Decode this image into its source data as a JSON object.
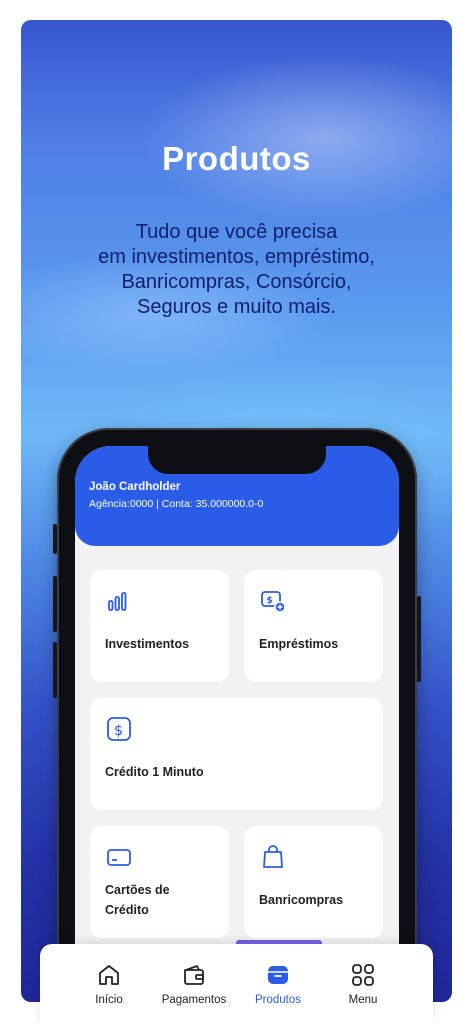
{
  "promo": {
    "title": "Produtos",
    "subtitle_lines": [
      "Tudo que você precisa",
      "em investimentos, empréstimo,",
      "Banricompras, Consórcio,",
      "Seguros e muito mais."
    ]
  },
  "account": {
    "name": "João Cardholder",
    "details": "Agência:0000  | Conta: 35.000000.0-0"
  },
  "products": [
    {
      "label": "Investimentos",
      "icon": "bar-chart-icon"
    },
    {
      "label": "Empréstimos",
      "icon": "loan-money-icon"
    },
    {
      "label": "Crédito 1 Minuto",
      "icon": "dollar-icon"
    },
    {
      "label_lines": [
        "Cartões de",
        "Crédito"
      ],
      "icon": "credit-card-icon"
    },
    {
      "label": "Banricompras",
      "icon": "shopping-bag-icon"
    }
  ],
  "nav": {
    "items": [
      {
        "label": "Início",
        "icon": "home-icon"
      },
      {
        "label": "Pagamentos",
        "icon": "wallet-icon"
      },
      {
        "label": "Produtos",
        "icon": "products-box-icon",
        "active": true
      },
      {
        "label": "Menu",
        "icon": "grid-menu-icon"
      }
    ]
  },
  "colors": {
    "accent": "#2a5ce8",
    "text_dark": "#222222"
  }
}
